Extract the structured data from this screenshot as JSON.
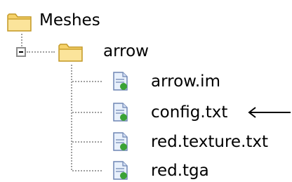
{
  "tree": {
    "root": {
      "label": "Meshes",
      "icon": "folder-icon"
    },
    "folder": {
      "label": "arrow",
      "icon": "folder-icon",
      "expanded": true,
      "expander_icon": "minus-box-icon"
    },
    "files": [
      {
        "label": "arrow.im",
        "icon": "file-icon"
      },
      {
        "label": "config.txt",
        "icon": "file-icon"
      },
      {
        "label": "red.texture.txt",
        "icon": "file-icon"
      },
      {
        "label": "red.tga",
        "icon": "file-icon"
      }
    ]
  },
  "annotation": {
    "icon": "left-arrow-icon",
    "points_to": "config.txt"
  },
  "colors": {
    "folder_fill": "#f6d26a",
    "folder_outline": "#c49a2a",
    "file_fill": "#e8f0fb",
    "file_outline": "#6f86b4",
    "file_badge": "#3aa335",
    "tree_lines": "#a0a0a0"
  }
}
